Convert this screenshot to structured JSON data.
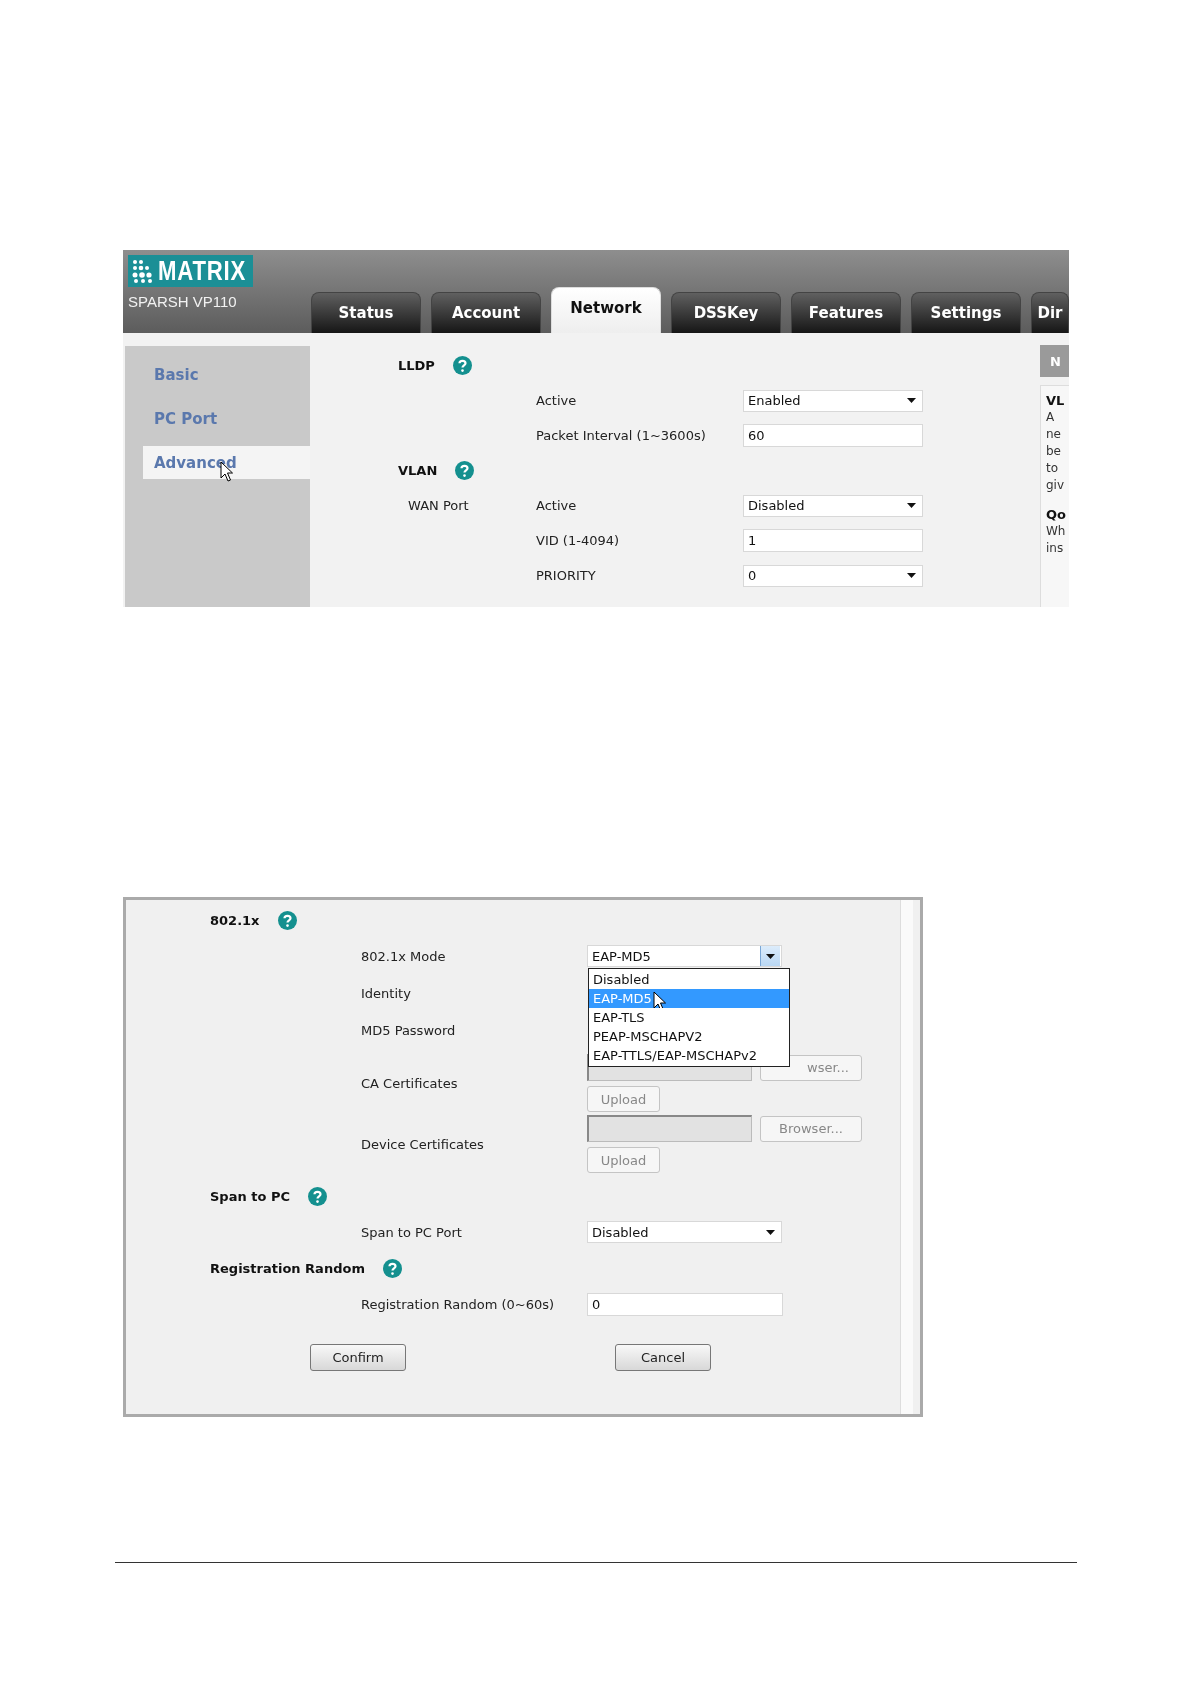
{
  "top_screenshot": {
    "logo": "MATRIX",
    "model": "SPARSH VP110",
    "tabs": [
      {
        "label": "Status",
        "selected": false
      },
      {
        "label": "Account",
        "selected": false
      },
      {
        "label": "Network",
        "selected": true
      },
      {
        "label": "DSSKey",
        "selected": false
      },
      {
        "label": "Features",
        "selected": false
      },
      {
        "label": "Settings",
        "selected": false
      },
      {
        "label": "Dir",
        "selected": false
      }
    ],
    "sidebar": {
      "items": [
        {
          "label": "Basic",
          "selected": false
        },
        {
          "label": "PC Port",
          "selected": false
        },
        {
          "label": "Advanced",
          "selected": true
        }
      ]
    },
    "sections": [
      {
        "title": "LLDP",
        "fields": [
          {
            "label": "Active",
            "kind": "select",
            "value": "Enabled"
          },
          {
            "label": "Packet Interval (1~3600s)",
            "kind": "input",
            "value": "60"
          }
        ]
      },
      {
        "title": "VLAN",
        "fields": [
          {
            "group": "WAN Port",
            "label": "Active",
            "kind": "select",
            "value": "Disabled"
          },
          {
            "label": "VID (1-4094)",
            "kind": "input",
            "value": "1"
          },
          {
            "label": "PRIORITY",
            "kind": "select",
            "value": "0"
          }
        ]
      }
    ],
    "notes": {
      "title": "N",
      "blocks": [
        {
          "heading": "VL",
          "lines": [
            "A",
            "ne",
            "be",
            "to",
            "giv"
          ]
        },
        {
          "heading": "Qo",
          "lines": [
            "Wh",
            "ins"
          ]
        }
      ]
    }
  },
  "bottom_screenshot": {
    "sections": [
      {
        "title": "802.1x",
        "fields": [
          {
            "label": "802.1x Mode",
            "kind": "select",
            "value": "EAP-MD5",
            "open": true,
            "options": [
              {
                "label": "Disabled",
                "selected": false
              },
              {
                "label": "EAP-MD5",
                "selected": true
              },
              {
                "label": "EAP-TLS",
                "selected": false
              },
              {
                "label": "PEAP-MSCHAPV2",
                "selected": false
              },
              {
                "label": "EAP-TTLS/EAP-MSCHAPv2",
                "selected": false
              }
            ]
          },
          {
            "label": "Identity",
            "kind": "covered"
          },
          {
            "label": "MD5 Password",
            "kind": "covered"
          },
          {
            "label": "CA Certificates",
            "kind": "file",
            "browse": "wser...",
            "upload": "Upload"
          },
          {
            "label": "Device Certificates",
            "kind": "file",
            "browse": "Browser...",
            "upload": "Upload"
          }
        ]
      },
      {
        "title": "Span to PC",
        "fields": [
          {
            "label": "Span to PC Port",
            "kind": "select",
            "value": "Disabled"
          }
        ]
      },
      {
        "title": "Registration Random",
        "fields": [
          {
            "label": "Registration Random (0~60s)",
            "kind": "input",
            "value": "0"
          }
        ]
      }
    ],
    "buttons": [
      "Confirm",
      "Cancel"
    ]
  }
}
